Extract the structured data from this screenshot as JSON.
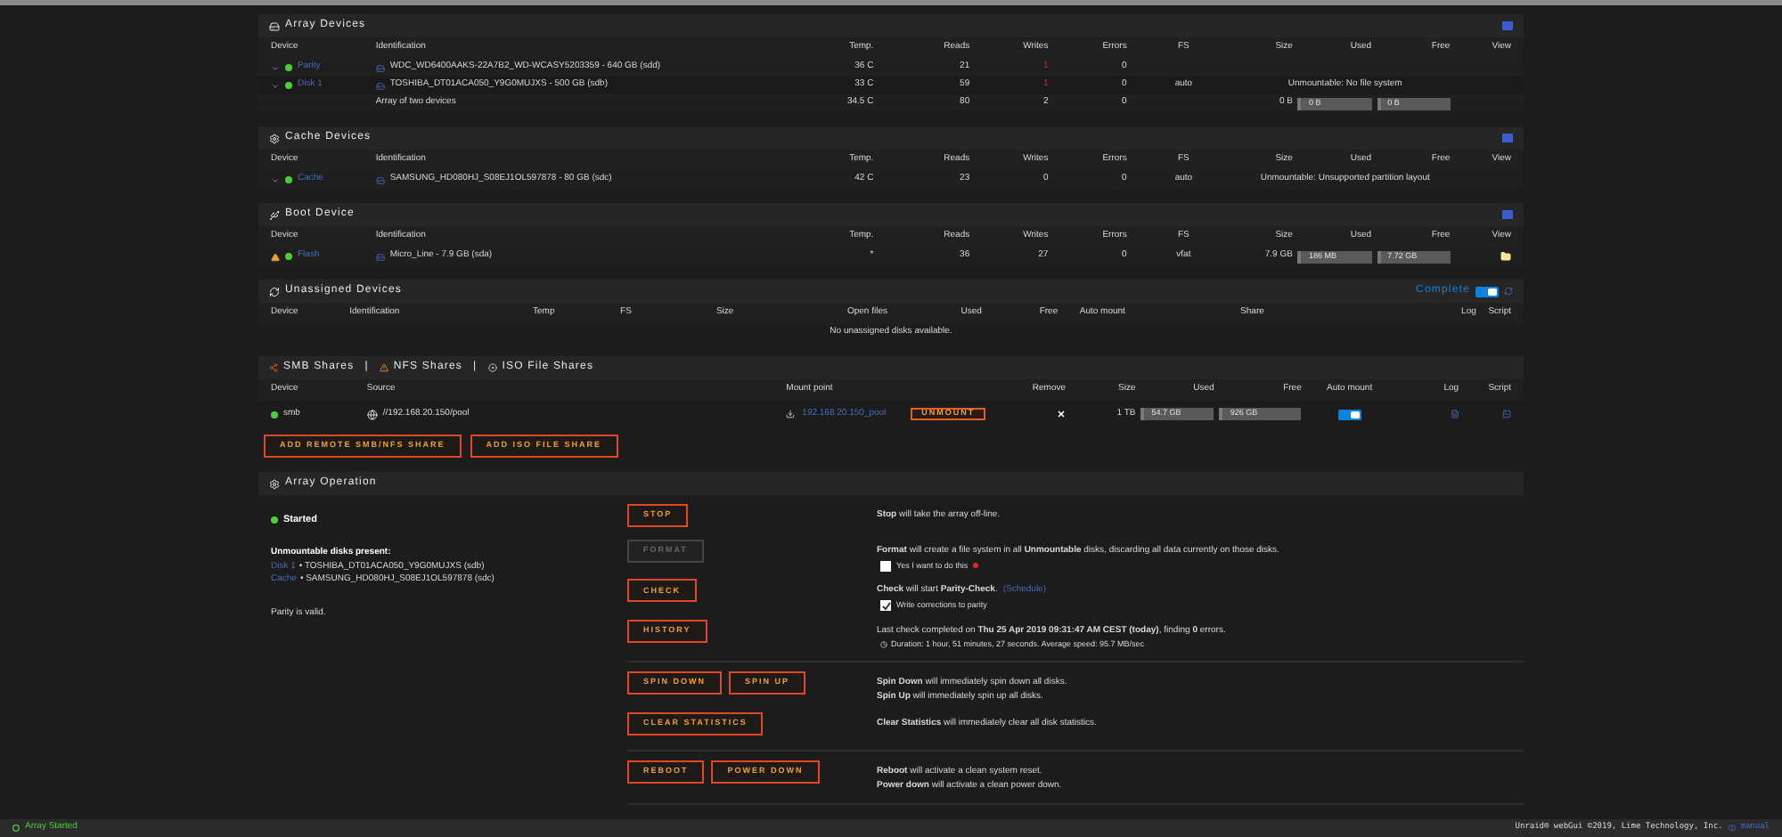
{
  "sections": [
    {
      "kind": "devices",
      "title": "Array Devices",
      "columns": [
        "Device",
        "Identification",
        "Temp.",
        "Reads",
        "Writes",
        "Errors",
        "FS",
        "Size",
        "Used",
        "Free",
        "View"
      ],
      "rows": [
        {
          "cells": [
            {
              "kind": "device",
              "text": "Parity",
              "warning": false
            },
            {
              "kind": "disk",
              "text": "WDC_WD6400AAKS-22A7B2_WD-WCASY5203359 - 640 GB (sdd)"
            },
            {
              "kind": "text",
              "text": "36 C"
            },
            {
              "kind": "text",
              "text": "21"
            },
            {
              "kind": "text",
              "text": "1",
              "alert": true
            },
            {
              "kind": "text",
              "text": "0"
            },
            null,
            null,
            null,
            null,
            null
          ]
        },
        {
          "cells": [
            {
              "kind": "device",
              "text": "Disk 1",
              "warning": false
            },
            {
              "kind": "disk",
              "text": "TOSHIBA_DT01ACA050_Y9G0MUJXS - 500 GB (sdb)"
            },
            {
              "kind": "text",
              "text": "33 C"
            },
            {
              "kind": "text",
              "text": "59"
            },
            {
              "kind": "text",
              "text": "1",
              "alert": true
            },
            {
              "kind": "text",
              "text": "0"
            },
            {
              "kind": "text",
              "text": "auto"
            },
            {
              "kind": "note",
              "text": "Unmountable: No file system"
            },
            null
          ]
        },
        {
          "cells": [
            null,
            {
              "kind": "text",
              "text": "Array of two devices"
            },
            {
              "kind": "text",
              "text": "34.5 C"
            },
            {
              "kind": "text",
              "text": "80"
            },
            {
              "kind": "text",
              "text": "2",
              "alert": false
            },
            {
              "kind": "text",
              "text": "0"
            },
            null,
            {
              "kind": "text",
              "text": "0 B"
            },
            {
              "kind": "bar",
              "text": "0 B"
            },
            {
              "kind": "bar",
              "text": "0 B"
            },
            null
          ]
        }
      ]
    },
    {
      "kind": "devices",
      "title": "Cache Devices",
      "columns": [
        "Device",
        "Identification",
        "Temp.",
        "Reads",
        "Writes",
        "Errors",
        "FS",
        "Size",
        "Used",
        "Free",
        "View"
      ],
      "rows": [
        {
          "cells": [
            {
              "kind": "device",
              "text": "Cache",
              "warning": false
            },
            {
              "kind": "disk",
              "text": "SAMSUNG_HD080HJ_S08EJ1OL597878 - 80 GB (sdc)"
            },
            {
              "kind": "text",
              "text": "42 C"
            },
            {
              "kind": "text",
              "text": "23"
            },
            {
              "kind": "text",
              "text": "0"
            },
            {
              "kind": "text",
              "text": "0"
            },
            {
              "kind": "text",
              "text": "auto"
            },
            {
              "kind": "note",
              "text": "Unmountable: Unsupported partition layout"
            },
            null
          ]
        }
      ]
    },
    {
      "kind": "devices",
      "title": "Boot Device",
      "columns": [
        "Device",
        "Identification",
        "Temp.",
        "Reads",
        "Writes",
        "Errors",
        "FS",
        "Size",
        "Used",
        "Free",
        "View"
      ],
      "rows": [
        {
          "cells": [
            {
              "kind": "device",
              "text": "Flash",
              "warning": true
            },
            {
              "kind": "disk",
              "text": "Micro_Line - 7.9 GB (sda)"
            },
            {
              "kind": "text",
              "text": "*"
            },
            {
              "kind": "text",
              "text": "36"
            },
            {
              "kind": "text",
              "text": "27"
            },
            {
              "kind": "text",
              "text": "0"
            },
            {
              "kind": "text",
              "text": "vfat"
            },
            {
              "kind": "text",
              "text": "7.9 GB"
            },
            {
              "kind": "bar",
              "text": "186 MB"
            },
            {
              "kind": "bar",
              "text": "7.72 GB"
            },
            {
              "kind": "view"
            }
          ]
        }
      ]
    },
    {
      "kind": "unassigned",
      "title": "Unassigned Devices",
      "mode": {
        "label": "Complete",
        "on": true
      },
      "columns": [
        "Device",
        "Identification",
        "Temp",
        "FS",
        "Size",
        "Open files",
        "Used",
        "Free",
        "Auto mount",
        "Share",
        "Log",
        "Script"
      ],
      "empty_message": "No unassigned disks available."
    },
    {
      "kind": "shares",
      "tabs": [
        {
          "label": "SMB Shares"
        },
        {
          "label": "NFS Shares"
        },
        {
          "label": "ISO File Shares"
        }
      ],
      "separator": "|",
      "columns": [
        "Device",
        "Source",
        "Mount point",
        "Remove",
        "Size",
        "Used",
        "Free",
        "Auto mount",
        "Log",
        "Script"
      ],
      "rows": [
        {
          "cells": [
            {
              "kind": "status",
              "text": "smb"
            },
            {
              "kind": "source",
              "text": "//192.168.20.150/pool"
            },
            {
              "kind": "mount",
              "text": "192.168.20.150_pool",
              "button": "UNMOUNT"
            },
            {
              "kind": "remove"
            },
            {
              "kind": "text",
              "text": "1 TB"
            },
            {
              "kind": "bar",
              "text": "54.7 GB"
            },
            {
              "kind": "bar",
              "text": "926 GB"
            },
            {
              "kind": "toggle",
              "on": true
            },
            {
              "kind": "log"
            },
            {
              "kind": "script"
            }
          ]
        }
      ],
      "buttons": [
        "ADD REMOTE SMB/NFS SHARE",
        "ADD ISO FILE SHARE"
      ]
    }
  ],
  "array_operation": {
    "title": "Array Operation",
    "status": "Started",
    "notice_title": "Unmountable disks present:",
    "unmountable": [
      {
        "device": "Disk 1",
        "detail": "• TOSHIBA_DT01ACA050_Y9G0MUJXS (sdb)"
      },
      {
        "device": "Cache",
        "detail": "• SAMSUNG_HD080HJ_S08EJ1OL597878 (sdc)"
      }
    ],
    "parity": "Parity is valid.",
    "groups": [
      [
        {
          "buttons": [
            {
              "label": "STOP",
              "disabled": false
            }
          ],
          "lines": [
            "**Stop** will take the array off-line."
          ]
        },
        {
          "buttons": [
            {
              "label": "FORMAT",
              "disabled": true
            }
          ],
          "lines": [
            "**Format** will create a file system in all **Unmountable** disks, discarding all data currently on those disks."
          ],
          "checkbox": {
            "label": "Yes I want to do this",
            "checked": false,
            "required": true
          }
        },
        {
          "buttons": [
            {
              "label": "CHECK",
              "disabled": false
            }
          ],
          "lines": [
            "**Check** will start **Parity-Check**."
          ],
          "link": "(Schedule)",
          "checkbox": {
            "label": "Write corrections to parity",
            "checked": true,
            "required": false
          }
        },
        {
          "buttons": [
            {
              "label": "HISTORY",
              "disabled": false
            }
          ],
          "lines": [
            "Last check completed on **Thu 25 Apr 2019 09:31:47 AM CEST (today)**, finding **0** errors."
          ],
          "detail": "Duration: 1 hour, 51 minutes, 27 seconds. Average speed: 95.7 MB/sec"
        }
      ],
      [
        {
          "buttons": [
            {
              "label": "SPIN DOWN",
              "disabled": false
            },
            {
              "label": "SPIN UP",
              "disabled": false
            }
          ],
          "lines": [
            "**Spin Down** will immediately spin down all disks.",
            "**Spin Up** will immediately spin up all disks."
          ]
        },
        {
          "buttons": [
            {
              "label": "CLEAR STATISTICS",
              "disabled": false
            }
          ],
          "lines": [
            "**Clear Statistics** will immediately clear all disk statistics."
          ]
        }
      ],
      [
        {
          "buttons": [
            {
              "label": "REBOOT",
              "disabled": false
            },
            {
              "label": "POWER DOWN",
              "disabled": false
            }
          ],
          "lines": [
            "**Reboot** will activate a clean system reset.",
            "**Power down** will activate a clean power down."
          ]
        }
      ]
    ]
  },
  "footer": {
    "status": "Array Started",
    "copyright": "Unraid® webGui ©2019, Lime Technology, Inc.",
    "link": "manual"
  }
}
